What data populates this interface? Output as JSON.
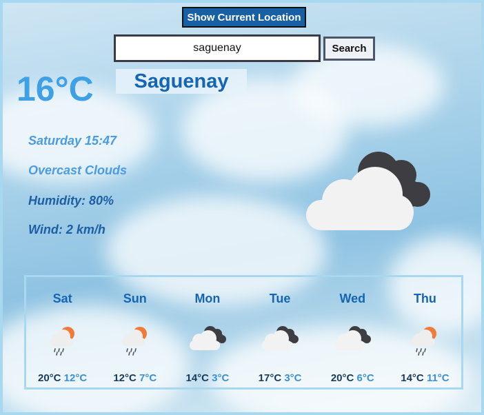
{
  "header": {
    "location_button": "Show Current Location"
  },
  "search": {
    "value": "saguenay",
    "button": "Search"
  },
  "current": {
    "temperature": "16°C",
    "city": "Saguenay",
    "datetime": "Saturday 15:47",
    "description": "Overcast Clouds",
    "humidity": "Humidity: 80%",
    "wind": "Wind: 2 km/h",
    "icon": "overcast-clouds-icon"
  },
  "forecast": [
    {
      "day": "Sat",
      "high": "20°C",
      "low": "12°C",
      "icon": "rain-sun-icon"
    },
    {
      "day": "Sun",
      "high": "12°C",
      "low": "7°C",
      "icon": "rain-sun-icon"
    },
    {
      "day": "Mon",
      "high": "14°C",
      "low": "3°C",
      "icon": "overcast-clouds-icon"
    },
    {
      "day": "Tue",
      "high": "17°C",
      "low": "3°C",
      "icon": "overcast-clouds-icon"
    },
    {
      "day": "Wed",
      "high": "20°C",
      "low": "6°C",
      "icon": "overcast-clouds-icon"
    },
    {
      "day": "Thu",
      "high": "14°C",
      "low": "11°C",
      "icon": "rain-sun-icon"
    }
  ],
  "colors": {
    "accent": "#1760a3",
    "temp": "#3fa0e6",
    "city": "#1565b2",
    "border": "#a8d8f0"
  }
}
